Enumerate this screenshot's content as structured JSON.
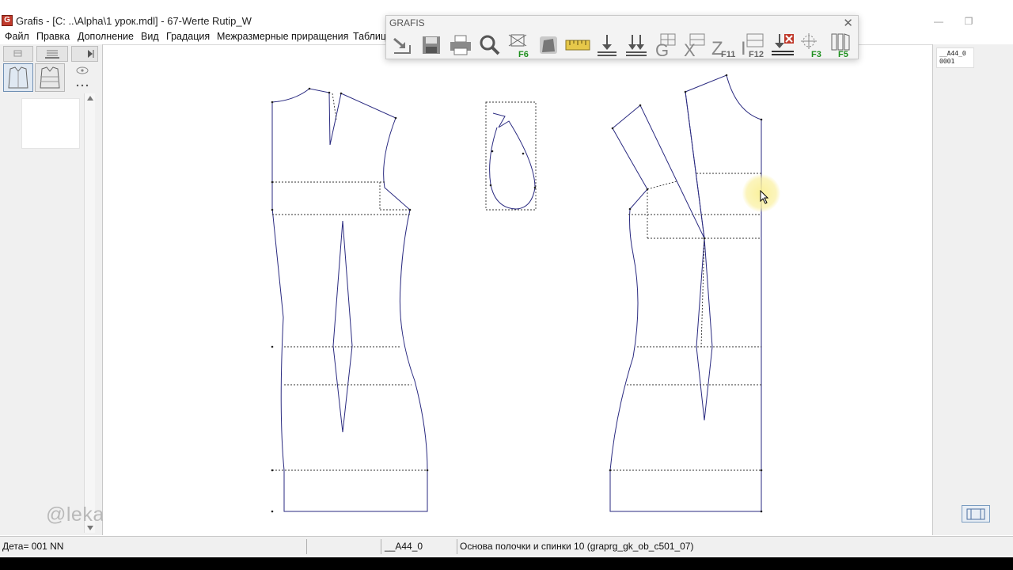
{
  "window": {
    "app_icon_letter": "G",
    "title": "Grafis - [C: ..\\Alpha\\1 урок.mdl] - 67-Werte Rutip_W",
    "minimize_glyph": "—",
    "maximize_glyph": "❐"
  },
  "menu": [
    {
      "label": "Файл"
    },
    {
      "label": "Правка"
    },
    {
      "label": "Дополнение"
    },
    {
      "label": "Вид"
    },
    {
      "label": "Градация"
    },
    {
      "label": "Межразмерные приращения"
    },
    {
      "label": "Таблиц"
    }
  ],
  "toolbar": {
    "title": "GRAFIS",
    "close_glyph": "✕",
    "buttons": [
      {
        "name": "open-icon",
        "key": ""
      },
      {
        "name": "save-icon",
        "key": ""
      },
      {
        "name": "print-icon",
        "key": ""
      },
      {
        "name": "zoom-icon",
        "key": ""
      },
      {
        "name": "fit-view-icon",
        "key": "F6"
      },
      {
        "name": "piece-icon",
        "key": ""
      },
      {
        "name": "measure-icon",
        "key": ""
      },
      {
        "name": "insert-icon",
        "key": ""
      },
      {
        "name": "insert-all-icon",
        "key": ""
      },
      {
        "name": "grading-icon",
        "key": "G"
      },
      {
        "name": "delete-construction-icon",
        "key": "X"
      },
      {
        "name": "step-back-icon",
        "key": "F11"
      },
      {
        "name": "step-forward-icon",
        "key": "F12"
      },
      {
        "name": "delete-step-icon",
        "key": ""
      },
      {
        "name": "point-info-icon",
        "key": "F3"
      },
      {
        "name": "pieces-icon",
        "key": "F5"
      }
    ]
  },
  "right_panel": {
    "size_line1": "__A44_0",
    "size_line2": "0001"
  },
  "watermark": "@lekala.proff",
  "statusbar": {
    "detail": "Дета= 001  NN",
    "size": "__A44_0",
    "construction": "Основа полочки и спинки 10 (graprg_gk_ob_c501_07)"
  },
  "colors": {
    "contour": "#2a2a80",
    "aux_line": "#333333",
    "key_green": "#1d8f1d"
  }
}
